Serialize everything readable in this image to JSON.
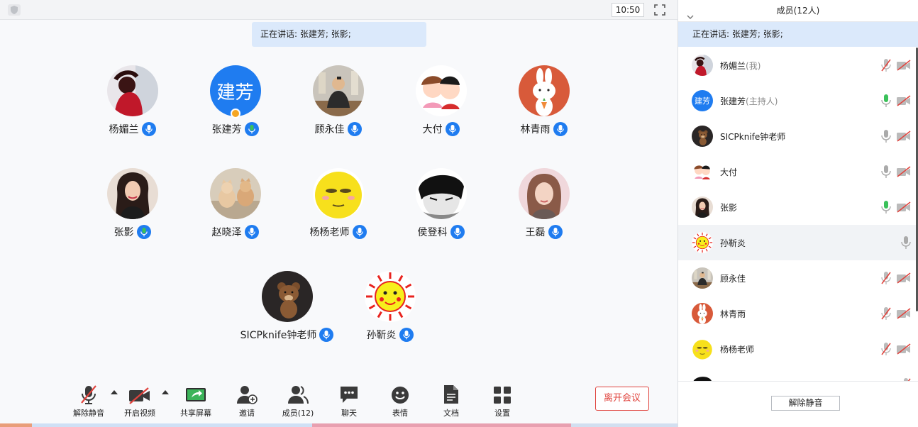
{
  "top": {
    "clock": "10:50"
  },
  "speaking_banner": "正在讲话: 张建芳; 张影;",
  "grid": [
    {
      "name": "杨媚兰",
      "mic": "blue",
      "av": "photo-red"
    },
    {
      "name": "张建芳",
      "mic": "green",
      "av": "text",
      "av_text": "建芳",
      "host": true
    },
    {
      "name": "顾永佳",
      "mic": "blue",
      "av": "photo-man"
    },
    {
      "name": "大付",
      "mic": "blue",
      "av": "cartoon"
    },
    {
      "name": "林青雨",
      "mic": "blue",
      "av": "bunny"
    },
    {
      "name": "张影",
      "mic": "green",
      "av": "photo-woman"
    },
    {
      "name": "赵晓泽",
      "mic": "blue",
      "av": "cats"
    },
    {
      "name": "杨杨老师",
      "mic": "blue",
      "av": "emoji"
    },
    {
      "name": "侯登科",
      "mic": "blue",
      "av": "manga"
    },
    {
      "name": "王磊",
      "mic": "blue",
      "av": "photo-girl"
    },
    {
      "name": "SICPknife钟老师",
      "mic": "blue",
      "av": "bear"
    },
    {
      "name": "孙靳炎",
      "mic": "blue",
      "av": "sun"
    }
  ],
  "toolbar": {
    "unmute": "解除静音",
    "video": "开启视频",
    "share": "共享屏幕",
    "invite": "邀请",
    "members": "成员(12)",
    "chat": "聊天",
    "emoji": "表情",
    "docs": "文档",
    "settings": "设置",
    "leave": "离开会议"
  },
  "side": {
    "title": "成员(12人)",
    "speaking": "正在讲话: 张建芳; 张影;",
    "unmute_all": "解除静音",
    "members": [
      {
        "name": "杨媚兰",
        "role": "(我)",
        "mic": "muted",
        "video": true,
        "av": "photo-red"
      },
      {
        "name": "张建芳",
        "role": "(主持人)",
        "mic": "active",
        "video": true,
        "av": "text",
        "av_text": "建芳"
      },
      {
        "name": "SICPknife钟老师",
        "role": "",
        "mic": "on",
        "video": true,
        "av": "bear"
      },
      {
        "name": "大付",
        "role": "",
        "mic": "on",
        "video": true,
        "av": "cartoon"
      },
      {
        "name": "张影",
        "role": "",
        "mic": "active",
        "video": true,
        "av": "photo-woman"
      },
      {
        "name": "孙靳炎",
        "role": "",
        "mic": "on",
        "video": false,
        "av": "sun",
        "hl": true
      },
      {
        "name": "顾永佳",
        "role": "",
        "mic": "muted",
        "video": true,
        "av": "photo-man"
      },
      {
        "name": "林青雨",
        "role": "",
        "mic": "muted",
        "video": true,
        "av": "bunny"
      },
      {
        "name": "杨杨老师",
        "role": "",
        "mic": "muted",
        "video": true,
        "av": "emoji"
      },
      {
        "name": "",
        "role": "",
        "mic": "muted",
        "video": false,
        "av": "manga"
      }
    ]
  }
}
